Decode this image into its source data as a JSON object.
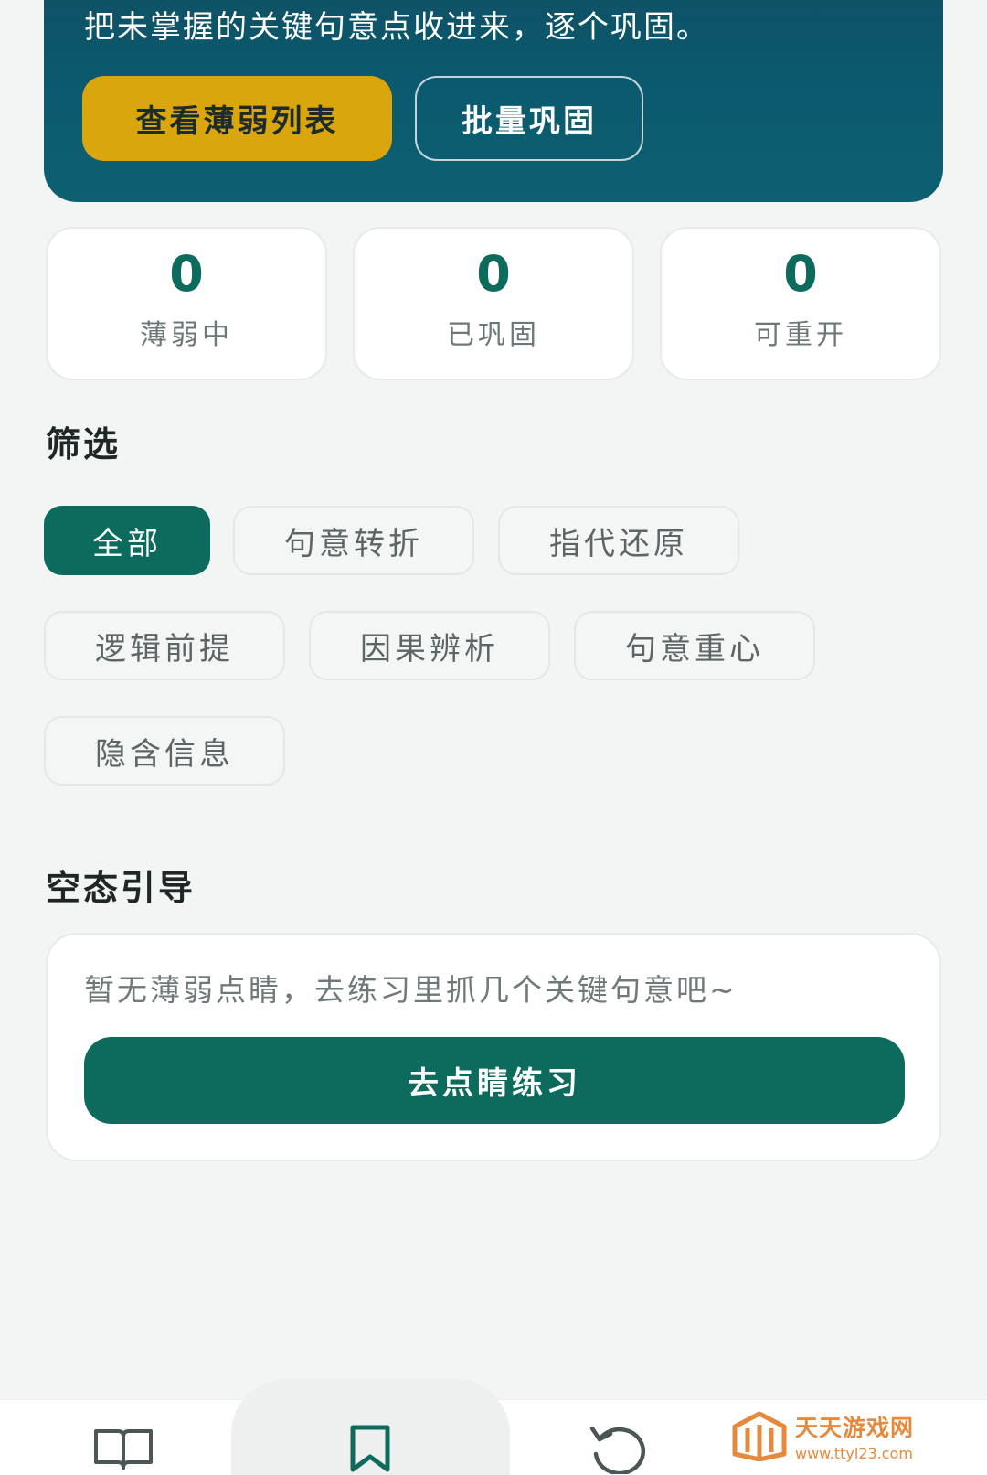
{
  "banner": {
    "subtitle": "把未掌握的关键句意点收进来，逐个巩固。",
    "btn_view_weak": "查看薄弱列表",
    "btn_batch": "批量巩固"
  },
  "stats": [
    {
      "value": "0",
      "label": "薄弱中"
    },
    {
      "value": "0",
      "label": "已巩固"
    },
    {
      "value": "0",
      "label": "可重开"
    }
  ],
  "filter": {
    "title": "筛选",
    "chips": [
      "全部",
      "句意转折",
      "指代还原",
      "逻辑前提",
      "因果辨析",
      "句意重心",
      "隐含信息"
    ],
    "active_index": 0
  },
  "empty": {
    "title": "空态引导",
    "text": "暂无薄弱点睛，去练习里抓几个关键句意吧~",
    "button": "去点睛练习"
  },
  "bottom_nav": {
    "items": [
      "book-icon",
      "bookmark-icon",
      "refresh-icon"
    ],
    "active_index": 1
  },
  "watermark": {
    "title": "天天游戏网",
    "url": "www.ttyl23.com"
  },
  "colors": {
    "primary": "#0c6b5c",
    "banner": "#0b5a6f",
    "accent_yellow": "#d9a60e",
    "watermark": "#e58a3d"
  }
}
